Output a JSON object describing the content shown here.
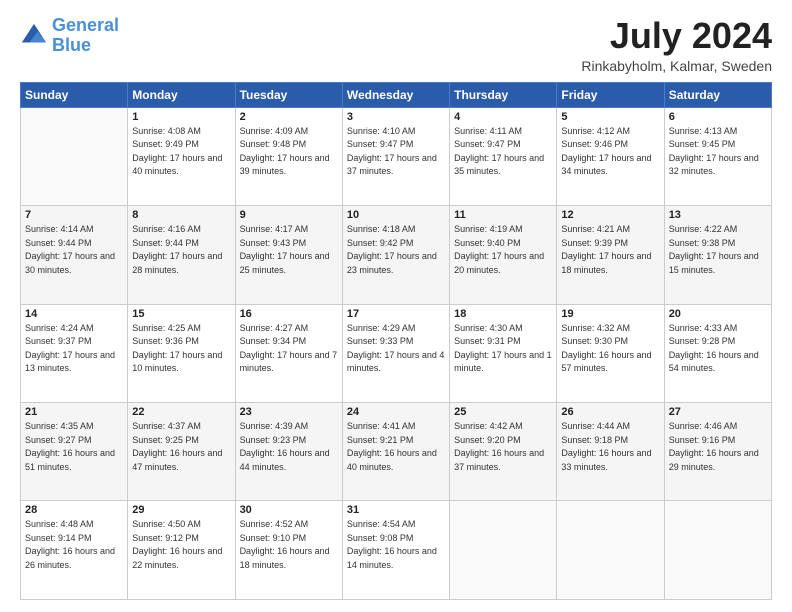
{
  "header": {
    "logo_line1": "General",
    "logo_line2": "Blue",
    "title": "July 2024",
    "location": "Rinkabyholm, Kalmar, Sweden"
  },
  "weekdays": [
    "Sunday",
    "Monday",
    "Tuesday",
    "Wednesday",
    "Thursday",
    "Friday",
    "Saturday"
  ],
  "weeks": [
    [
      {
        "day": "",
        "sunrise": "",
        "sunset": "",
        "daylight": ""
      },
      {
        "day": "1",
        "sunrise": "4:08 AM",
        "sunset": "9:49 PM",
        "daylight": "17 hours and 40 minutes."
      },
      {
        "day": "2",
        "sunrise": "4:09 AM",
        "sunset": "9:48 PM",
        "daylight": "17 hours and 39 minutes."
      },
      {
        "day": "3",
        "sunrise": "4:10 AM",
        "sunset": "9:47 PM",
        "daylight": "17 hours and 37 minutes."
      },
      {
        "day": "4",
        "sunrise": "4:11 AM",
        "sunset": "9:47 PM",
        "daylight": "17 hours and 35 minutes."
      },
      {
        "day": "5",
        "sunrise": "4:12 AM",
        "sunset": "9:46 PM",
        "daylight": "17 hours and 34 minutes."
      },
      {
        "day": "6",
        "sunrise": "4:13 AM",
        "sunset": "9:45 PM",
        "daylight": "17 hours and 32 minutes."
      }
    ],
    [
      {
        "day": "7",
        "sunrise": "4:14 AM",
        "sunset": "9:44 PM",
        "daylight": "17 hours and 30 minutes."
      },
      {
        "day": "8",
        "sunrise": "4:16 AM",
        "sunset": "9:44 PM",
        "daylight": "17 hours and 28 minutes."
      },
      {
        "day": "9",
        "sunrise": "4:17 AM",
        "sunset": "9:43 PM",
        "daylight": "17 hours and 25 minutes."
      },
      {
        "day": "10",
        "sunrise": "4:18 AM",
        "sunset": "9:42 PM",
        "daylight": "17 hours and 23 minutes."
      },
      {
        "day": "11",
        "sunrise": "4:19 AM",
        "sunset": "9:40 PM",
        "daylight": "17 hours and 20 minutes."
      },
      {
        "day": "12",
        "sunrise": "4:21 AM",
        "sunset": "9:39 PM",
        "daylight": "17 hours and 18 minutes."
      },
      {
        "day": "13",
        "sunrise": "4:22 AM",
        "sunset": "9:38 PM",
        "daylight": "17 hours and 15 minutes."
      }
    ],
    [
      {
        "day": "14",
        "sunrise": "4:24 AM",
        "sunset": "9:37 PM",
        "daylight": "17 hours and 13 minutes."
      },
      {
        "day": "15",
        "sunrise": "4:25 AM",
        "sunset": "9:36 PM",
        "daylight": "17 hours and 10 minutes."
      },
      {
        "day": "16",
        "sunrise": "4:27 AM",
        "sunset": "9:34 PM",
        "daylight": "17 hours and 7 minutes."
      },
      {
        "day": "17",
        "sunrise": "4:29 AM",
        "sunset": "9:33 PM",
        "daylight": "17 hours and 4 minutes."
      },
      {
        "day": "18",
        "sunrise": "4:30 AM",
        "sunset": "9:31 PM",
        "daylight": "17 hours and 1 minute."
      },
      {
        "day": "19",
        "sunrise": "4:32 AM",
        "sunset": "9:30 PM",
        "daylight": "16 hours and 57 minutes."
      },
      {
        "day": "20",
        "sunrise": "4:33 AM",
        "sunset": "9:28 PM",
        "daylight": "16 hours and 54 minutes."
      }
    ],
    [
      {
        "day": "21",
        "sunrise": "4:35 AM",
        "sunset": "9:27 PM",
        "daylight": "16 hours and 51 minutes."
      },
      {
        "day": "22",
        "sunrise": "4:37 AM",
        "sunset": "9:25 PM",
        "daylight": "16 hours and 47 minutes."
      },
      {
        "day": "23",
        "sunrise": "4:39 AM",
        "sunset": "9:23 PM",
        "daylight": "16 hours and 44 minutes."
      },
      {
        "day": "24",
        "sunrise": "4:41 AM",
        "sunset": "9:21 PM",
        "daylight": "16 hours and 40 minutes."
      },
      {
        "day": "25",
        "sunrise": "4:42 AM",
        "sunset": "9:20 PM",
        "daylight": "16 hours and 37 minutes."
      },
      {
        "day": "26",
        "sunrise": "4:44 AM",
        "sunset": "9:18 PM",
        "daylight": "16 hours and 33 minutes."
      },
      {
        "day": "27",
        "sunrise": "4:46 AM",
        "sunset": "9:16 PM",
        "daylight": "16 hours and 29 minutes."
      }
    ],
    [
      {
        "day": "28",
        "sunrise": "4:48 AM",
        "sunset": "9:14 PM",
        "daylight": "16 hours and 26 minutes."
      },
      {
        "day": "29",
        "sunrise": "4:50 AM",
        "sunset": "9:12 PM",
        "daylight": "16 hours and 22 minutes."
      },
      {
        "day": "30",
        "sunrise": "4:52 AM",
        "sunset": "9:10 PM",
        "daylight": "16 hours and 18 minutes."
      },
      {
        "day": "31",
        "sunrise": "4:54 AM",
        "sunset": "9:08 PM",
        "daylight": "16 hours and 14 minutes."
      },
      {
        "day": "",
        "sunrise": "",
        "sunset": "",
        "daylight": ""
      },
      {
        "day": "",
        "sunrise": "",
        "sunset": "",
        "daylight": ""
      },
      {
        "day": "",
        "sunrise": "",
        "sunset": "",
        "daylight": ""
      }
    ]
  ]
}
